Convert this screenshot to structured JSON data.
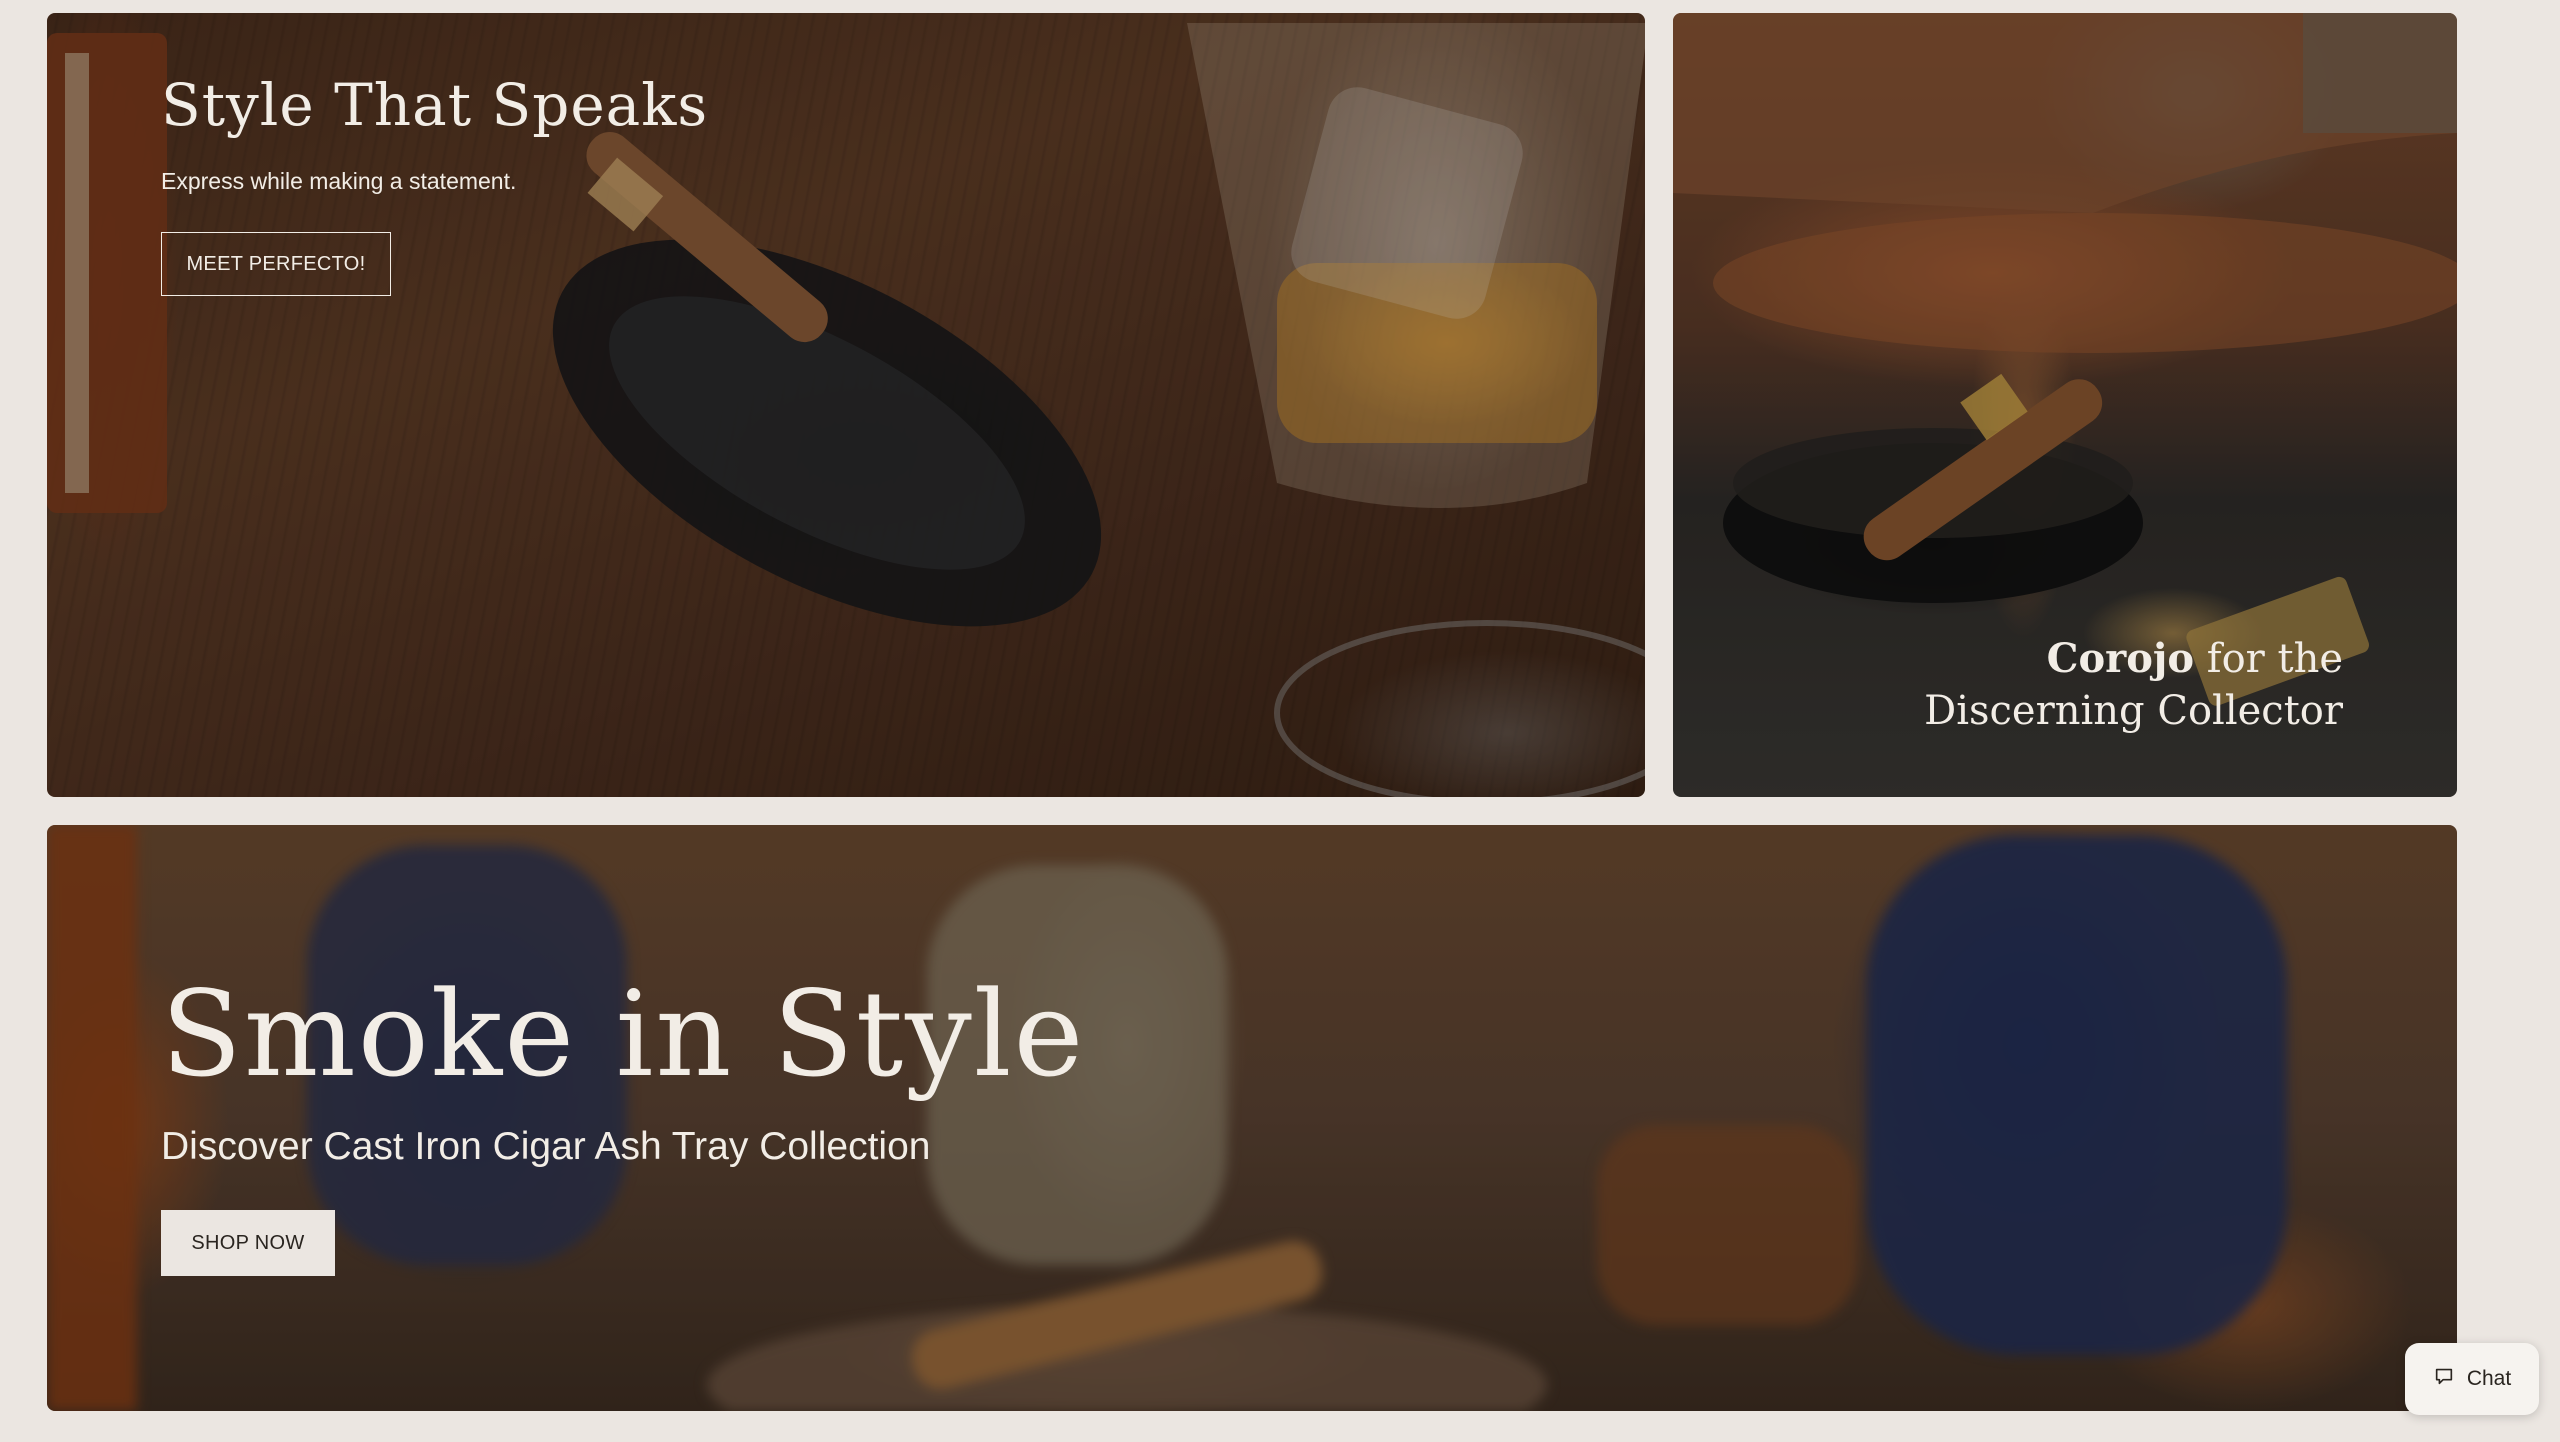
{
  "tiles": {
    "style_that_speaks": {
      "title": "Style That Speaks",
      "subtitle": "Express while making a statement.",
      "button_label": "MEET PERFECTO!"
    },
    "corojo": {
      "title_strong": "Corojo",
      "title_rest": "for the Discerning Collector"
    },
    "smoke_in_style": {
      "title": "Smoke in Style",
      "subtitle": "Discover Cast Iron Cigar Ash Tray Collection",
      "button_label": "SHOP NOW"
    }
  },
  "chat_widget": {
    "label": "Chat",
    "icon": "chat-bubble-icon"
  },
  "colors": {
    "page_background": "#ebe6e1",
    "overlay_text": "#f2ede6",
    "dark_text": "#2a2520"
  }
}
